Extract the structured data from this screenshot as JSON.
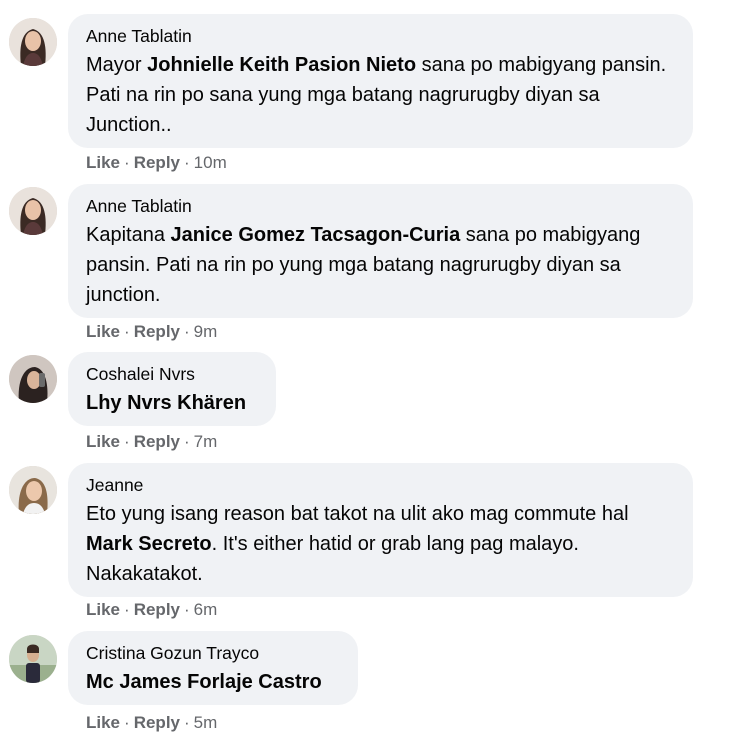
{
  "comments": [
    {
      "author": "Anne Tablatin",
      "text": [
        "Mayor ",
        "Johnielle Keith Pasion Nieto",
        " sana po mabigyang pansin. Pati na rin po sana yung mga batang nagrurugby diyan sa Junction.."
      ],
      "like": "Like",
      "reply": "Reply",
      "time": "10m",
      "avatar": "woman-long-hair-avatar"
    },
    {
      "author": "Anne Tablatin",
      "text": [
        "Kapitana ",
        "Janice Gomez Tacsagon-Curia",
        " sana po mabigyang pansin. Pati na rin po yung mga batang nagrurugby diyan sa junction."
      ],
      "like": "Like",
      "reply": "Reply",
      "time": "9m",
      "avatar": "woman-long-hair-avatar"
    },
    {
      "author": "Coshalei Nvrs",
      "text": [
        "",
        "Lhy Nvrs Khären",
        ""
      ],
      "like": "Like",
      "reply": "Reply",
      "time": "7m",
      "avatar": "woman-selfie-avatar"
    },
    {
      "author": "Jeanne",
      "text": [
        "Eto yung isang reason bat takot na ulit ako mag commute hal ",
        "Mark Secreto",
        ". It's either hatid or grab lang pag malayo. Nakakatakot."
      ],
      "like": "Like",
      "reply": "Reply",
      "time": "6m",
      "avatar": "woman-blonde-avatar"
    },
    {
      "author": "Cristina Gozun Trayco",
      "text": [
        "",
        "Mc James Forlaje Castro",
        ""
      ],
      "like": "Like",
      "reply": "Reply",
      "time": "5m",
      "avatar": "person-outdoor-avatar"
    }
  ],
  "colors": {
    "bubble": "#f0f2f5",
    "meta": "#65676b",
    "text": "#050505"
  }
}
